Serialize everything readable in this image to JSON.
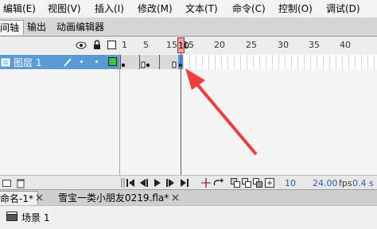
{
  "menu": {
    "items": [
      "编辑(E)",
      "视图(V)",
      "插入(I)",
      "修改(M)",
      "文本(T)",
      "命令(C)",
      "控制(O)",
      "调试(D)"
    ]
  },
  "panel_tabs": {
    "timeline": "间轴",
    "output": "输出",
    "motion_editor": "动画编辑器"
  },
  "timeline": {
    "ruler_numbers": [
      "1",
      "5",
      "10",
      "15",
      "20",
      "25",
      "30",
      "35",
      "40"
    ],
    "current_frame": "10",
    "layer_name": "图层 1",
    "frame_readout": "10",
    "fps_readout": "24.00",
    "fps_unit": "fps",
    "time_readout": "0.4 s"
  },
  "documents": {
    "tab1": "命名-1*",
    "tab2": "雪宝一类小朋友0219.fla*"
  },
  "scene": {
    "label": "场景 1"
  },
  "colors": {
    "layer_highlight": "#5b9bd5",
    "playhead": "#e0282e",
    "arrow": "#f03c3c",
    "fps_text": "#2a5fb0"
  }
}
